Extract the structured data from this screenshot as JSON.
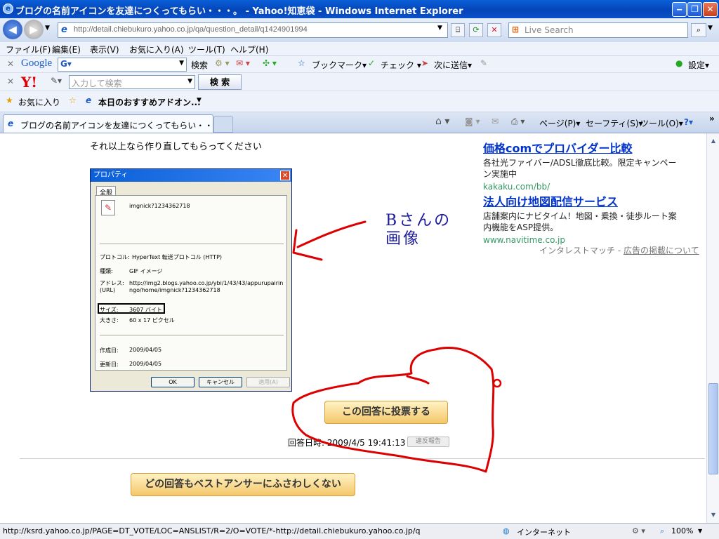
{
  "window": {
    "title": "ブログの名前アイコンを友達につくってもらい・・・。 - Yahoo!知恵袋 - Windows Internet Explorer",
    "icon": "ie-icon",
    "minimize": "‒",
    "restore": "❐",
    "close": "✕"
  },
  "nav": {
    "back_glyph": "◀",
    "forward_glyph": "▶",
    "url": "http://detail.chiebukuro.yahoo.co.jp/qa/question_detail/q1424901994",
    "search_placeholder": "Live Search",
    "refresh_glyph": "⟳",
    "stop_glyph": "✕"
  },
  "menubar": [
    "ファイル(F)",
    "編集(E)",
    "表示(V)",
    "お気に入り(A)",
    "ツール(T)",
    "ヘルプ(H)"
  ],
  "google_toolbar": {
    "logo": "Google",
    "search_label": "検索",
    "bookmarks": "ブックマーク▾",
    "check": "チェック ▾",
    "send_to": "次に送信▾",
    "settings": "設定▾"
  },
  "yahoo_toolbar": {
    "logo": "Y!",
    "input_placeholder": "入力して検索",
    "search_button": "検 索"
  },
  "favorites_bar": {
    "favorites": "お気に入り",
    "suggested": "本日のおすすめアドオン..."
  },
  "tabbar": {
    "tab_title": "ブログの名前アイコンを友達につくってもらい・・・。 - Yaho...",
    "page": "ページ(P)▾",
    "safety": "セーフティ(S)▾",
    "tools": "ツール(O)▾",
    "help": "?▾",
    "chevron": "»"
  },
  "content": {
    "intro_text": "それ以上なら作り直してもらってください",
    "annotation": "Bさんの\n画像",
    "vote_button": "この回答に投票する",
    "answer_date_label": "回答日時:",
    "answer_date": "2009/4/5 19:41:13",
    "report_button": "違反報告",
    "no_best_button": "どの回答もベストアンサーにふさわしくない"
  },
  "dialog": {
    "title": "プロパティ",
    "tab": "全般",
    "name": "imgnick?1234362718",
    "protocol_label": "プロトコル:",
    "protocol": "HyperText 転送プロトコル (HTTP)",
    "type_label": "種類:",
    "type": "GIF イメージ",
    "address_label": "アドレス:\n(URL)",
    "address": "http://img2.blogs.yahoo.co.jp/ybi/1/43/43/appurupairin\nngo/home/imgnick?1234362718",
    "size_label": "サイズ:",
    "size": "3607 バイト",
    "dims_label": "大きさ:",
    "dims": "60 x 17 ピクセル",
    "created_label": "作成日:",
    "created": "2009/04/05",
    "modified_label": "更新日:",
    "modified": "2009/04/05",
    "ok": "OK",
    "cancel": "キャンセル",
    "apply": "適用(A)"
  },
  "ads": [
    {
      "headline": "価格comでプロバイダー比較",
      "desc": "各社光ファイバー/ADSL徹底比較。限定キャンペーン実施中",
      "url": "kakaku.com/bb/"
    },
    {
      "headline": "法人向け地図配信サービス",
      "desc": "店舗案内にナビタイム！地図・乗換・徒歩ルート案内機能をASP提供。",
      "url": "www.navitime.co.jp"
    }
  ],
  "interest_match": {
    "prefix": "インタレストマッチ - ",
    "link": "広告の掲載について"
  },
  "statusbar": {
    "status_url": "http://ksrd.yahoo.co.jp/PAGE=DT_VOTE/LOC=ANSLIST/R=2/O=VOTE/*-http://detail.chiebukuro.yahoo.co.jp/q",
    "zone": "インターネット",
    "zoom": "100%"
  }
}
